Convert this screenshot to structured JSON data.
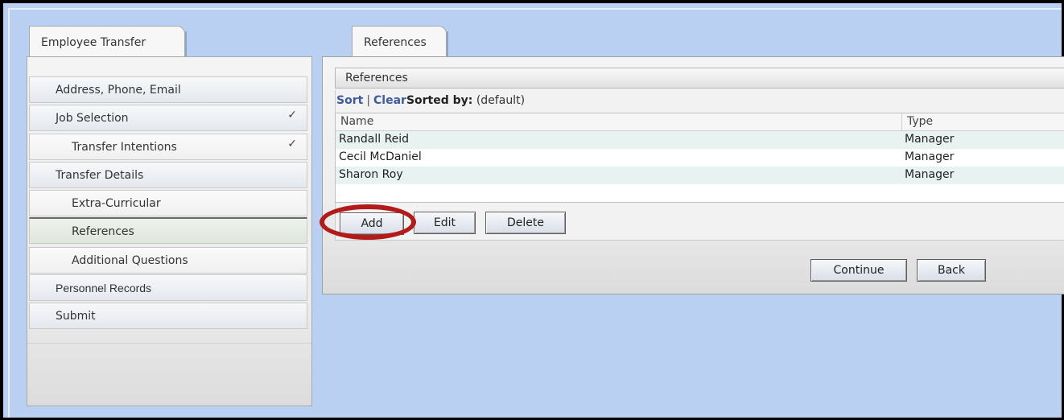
{
  "left_tab": {
    "label": "Employee Transfer"
  },
  "right_tab": {
    "label": "References"
  },
  "nav": {
    "items": [
      {
        "label": "Address, Phone, Email",
        "checked": false
      },
      {
        "label": "Job Selection",
        "checked": true,
        "check": "✓"
      },
      {
        "label": "Transfer Intentions",
        "checked": true,
        "check": "✓"
      },
      {
        "label": "Transfer Details",
        "checked": false
      },
      {
        "label": "Extra-Curricular",
        "checked": false
      },
      {
        "label": "References",
        "checked": false,
        "active": true
      },
      {
        "label": "Additional Questions",
        "checked": false
      },
      {
        "label": "Personnel Records",
        "checked": false
      },
      {
        "label": "Submit",
        "checked": false
      }
    ]
  },
  "section": {
    "title": "References"
  },
  "sort_bar": {
    "sort_label": "Sort",
    "separator": "|",
    "clear_label": "Clear",
    "sorted_by_label": "Sorted by:",
    "sorted_by_value": "(default)"
  },
  "table": {
    "columns": [
      "Name",
      "Type"
    ],
    "rows": [
      {
        "name": "Randall Reid",
        "type": "Manager"
      },
      {
        "name": "Cecil McDaniel",
        "type": "Manager"
      },
      {
        "name": "Sharon Roy",
        "type": "Manager"
      }
    ]
  },
  "buttons": {
    "add": "Add",
    "edit": "Edit",
    "delete": "Delete",
    "continue": "Continue",
    "back": "Back"
  },
  "colors": {
    "page_background": "#b9d0f3",
    "link": "#3d5a9e",
    "highlight": "#b31b1b",
    "row_alt": "#e8f2f0"
  }
}
